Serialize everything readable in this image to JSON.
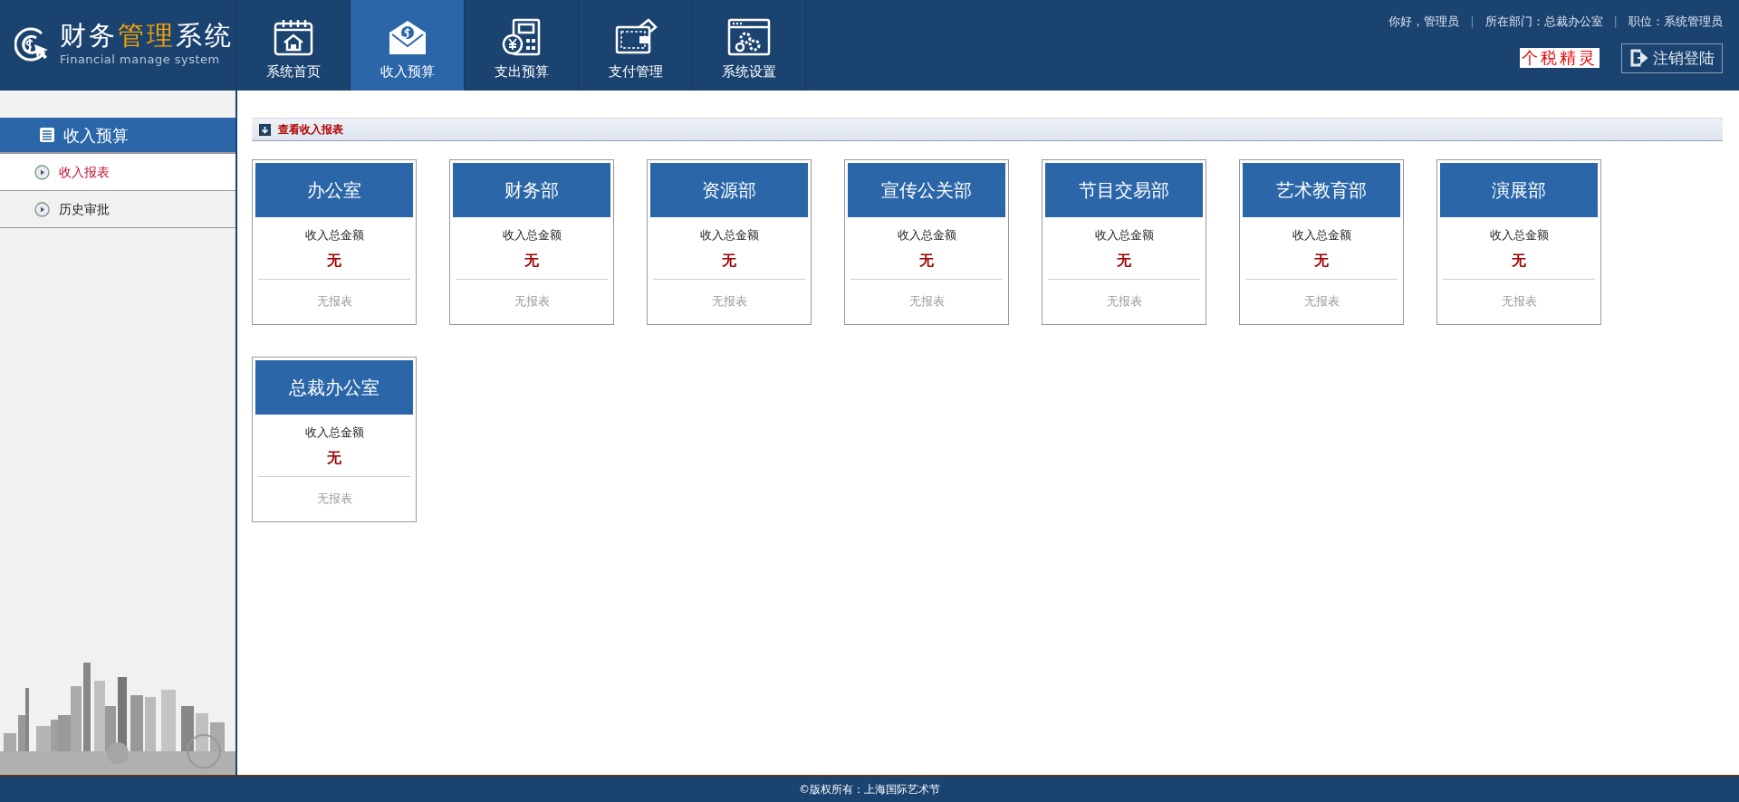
{
  "logo": {
    "title": [
      {
        "text": "财务",
        "accent": false
      },
      {
        "text": "管理",
        "accent": true
      },
      {
        "text": "系统",
        "accent": false
      }
    ],
    "subtitle": "Financial manage system"
  },
  "nav": [
    {
      "label": "系统首页",
      "selected": false
    },
    {
      "label": "收入预算",
      "selected": true
    },
    {
      "label": "支出预算",
      "selected": false
    },
    {
      "label": "支付管理",
      "selected": false
    },
    {
      "label": "系统设置",
      "selected": false
    }
  ],
  "user_info": [
    {
      "kind": "info",
      "text": "你好，管理员"
    },
    {
      "kind": "separator",
      "text": "|"
    },
    {
      "kind": "info",
      "text": "所在部门：总裁办公室"
    },
    {
      "kind": "separator",
      "text": "|"
    },
    {
      "kind": "info",
      "text": "职位：系统管理员"
    }
  ],
  "tax_link": "个税精灵",
  "logout_button": "注销登陆",
  "sidebar": {
    "title": "收入预算",
    "items": [
      {
        "label": "收入报表",
        "selected": true
      },
      {
        "label": "历史审批",
        "selected": false
      }
    ]
  },
  "section_title": "查看收入报表",
  "cards": [
    {
      "department": "办公室",
      "amount_label": "收入总金额",
      "amount": "无",
      "report": "无报表"
    },
    {
      "department": "财务部",
      "amount_label": "收入总金额",
      "amount": "无",
      "report": "无报表"
    },
    {
      "department": "资源部",
      "amount_label": "收入总金额",
      "amount": "无",
      "report": "无报表"
    },
    {
      "department": "宣传公关部",
      "amount_label": "收入总金额",
      "amount": "无",
      "report": "无报表"
    },
    {
      "department": "节目交易部",
      "amount_label": "收入总金额",
      "amount": "无",
      "report": "无报表"
    },
    {
      "department": "艺术教育部",
      "amount_label": "收入总金额",
      "amount": "无",
      "report": "无报表"
    },
    {
      "department": "演展部",
      "amount_label": "收入总金额",
      "amount": "无",
      "report": "无报表"
    },
    {
      "department": "总裁办公室",
      "amount_label": "收入总金额",
      "amount": "无",
      "report": "无报表"
    }
  ],
  "footer": "©版权所有：上海国际艺术节"
}
